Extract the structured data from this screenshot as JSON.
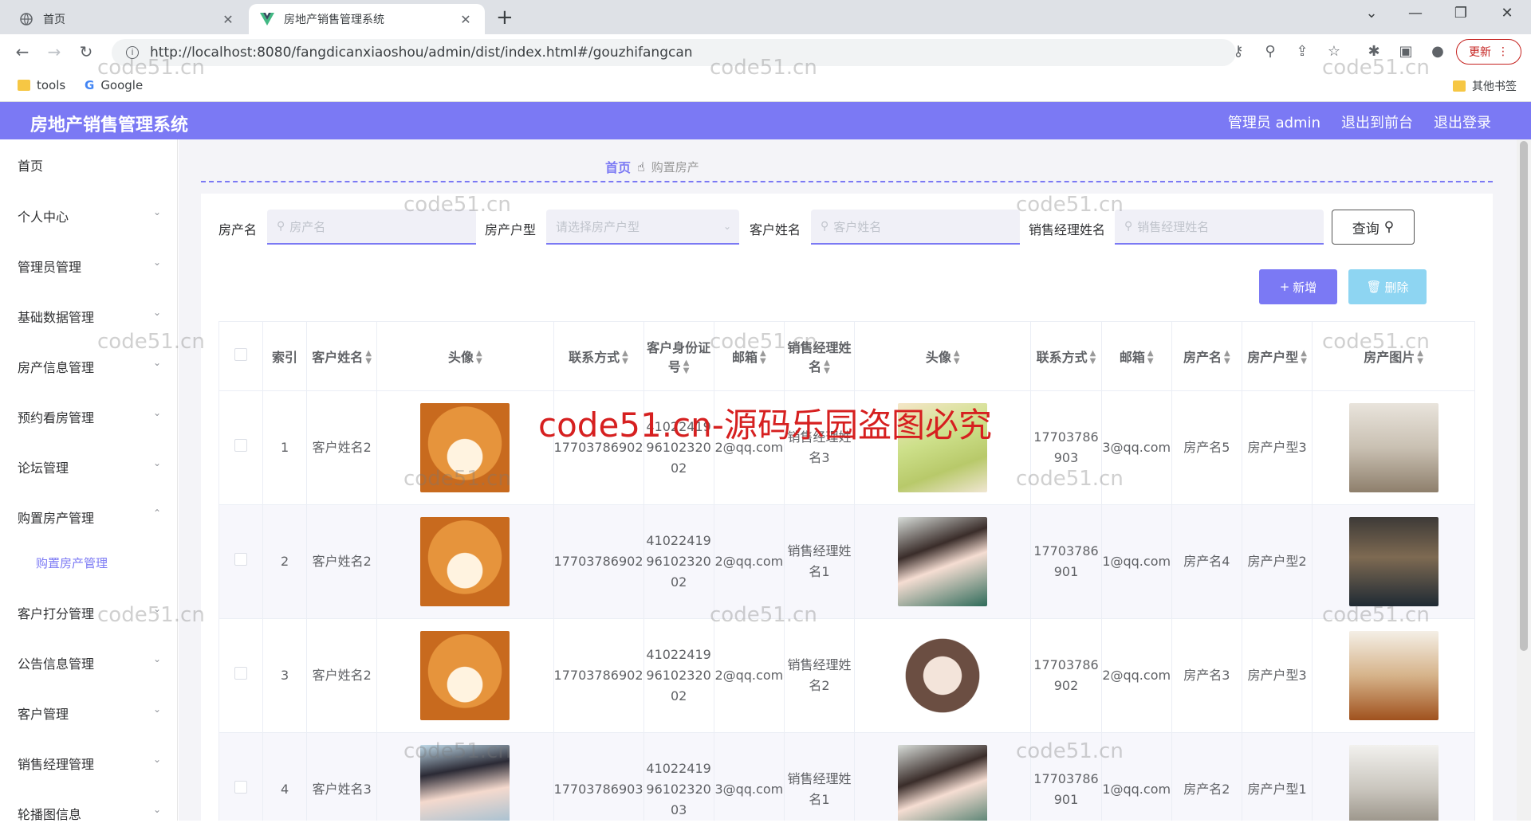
{
  "browser": {
    "tabs": [
      {
        "title": "首页"
      },
      {
        "title": "房地产销售管理系统"
      }
    ],
    "url": "http://localhost:8080/fangdicanxiaoshou/admin/dist/index.html#/gouzhifangcan",
    "update_label": "更新",
    "bookmarks": [
      {
        "label": "tools"
      },
      {
        "label": "Google"
      },
      {
        "label": "其他书签"
      }
    ]
  },
  "header": {
    "title": "房地产销售管理系统",
    "admin": "管理员 admin",
    "to_front": "退出到前台",
    "logout": "退出登录"
  },
  "sidebar": {
    "items": [
      {
        "label": "首页"
      },
      {
        "label": "个人中心"
      },
      {
        "label": "管理员管理"
      },
      {
        "label": "基础数据管理"
      },
      {
        "label": "房产信息管理"
      },
      {
        "label": "预约看房管理"
      },
      {
        "label": "论坛管理"
      },
      {
        "label": "购置房产管理"
      },
      {
        "label": "购置房产管理"
      },
      {
        "label": "客户打分管理"
      },
      {
        "label": "公告信息管理"
      },
      {
        "label": "客户管理"
      },
      {
        "label": "销售经理管理"
      },
      {
        "label": "轮播图信息"
      }
    ]
  },
  "breadcrumb": {
    "home": "首页",
    "current": "购置房产"
  },
  "search": {
    "f1_label": "房产名",
    "f1_placeholder": "房产名",
    "f2_label": "房产户型",
    "f2_placeholder": "请选择房产户型",
    "f3_label": "客户姓名",
    "f3_placeholder": "客户姓名",
    "f4_label": "销售经理姓名",
    "f4_placeholder": "销售经理姓名",
    "query_label": "查询"
  },
  "actions": {
    "add_label": "新增",
    "delete_label": "删除"
  },
  "table": {
    "headers": {
      "index": "索引",
      "customer_name": "客户姓名",
      "avatar": "头像",
      "contact": "联系方式",
      "id_card": "客户身份证号",
      "email": "邮箱",
      "manager_name": "销售经理姓名",
      "manager_avatar": "头像",
      "manager_contact": "联系方式",
      "manager_email": "邮箱",
      "house_name": "房产名",
      "house_type": "房产户型",
      "house_image": "房产图片"
    },
    "rows": [
      {
        "index": "1",
        "customer": "客户姓名2",
        "phone": "17703786902",
        "idcard": "410224199610232002",
        "email": "2@qq.com",
        "manager": "销售经理姓名3",
        "mphone": "17703786903",
        "memail": "3@qq.com",
        "house": "房产名5",
        "type": "房产户型3"
      },
      {
        "index": "2",
        "customer": "客户姓名2",
        "phone": "17703786902",
        "idcard": "410224199610232002",
        "email": "2@qq.com",
        "manager": "销售经理姓名1",
        "mphone": "17703786901",
        "memail": "1@qq.com",
        "house": "房产名4",
        "type": "房产户型2"
      },
      {
        "index": "3",
        "customer": "客户姓名2",
        "phone": "17703786902",
        "idcard": "410224199610232002",
        "email": "2@qq.com",
        "manager": "销售经理姓名2",
        "mphone": "17703786902",
        "memail": "2@qq.com",
        "house": "房产名3",
        "type": "房产户型3"
      },
      {
        "index": "4",
        "customer": "客户姓名3",
        "phone": "17703786903",
        "idcard": "410224199610232003",
        "email": "3@qq.com",
        "manager": "销售经理姓名1",
        "mphone": "17703786901",
        "memail": "1@qq.com",
        "house": "房产名2",
        "type": "房产户型1"
      }
    ]
  },
  "watermark": {
    "text": "code51.cn",
    "banner": "code51.cn-源码乐园盗图必究"
  }
}
